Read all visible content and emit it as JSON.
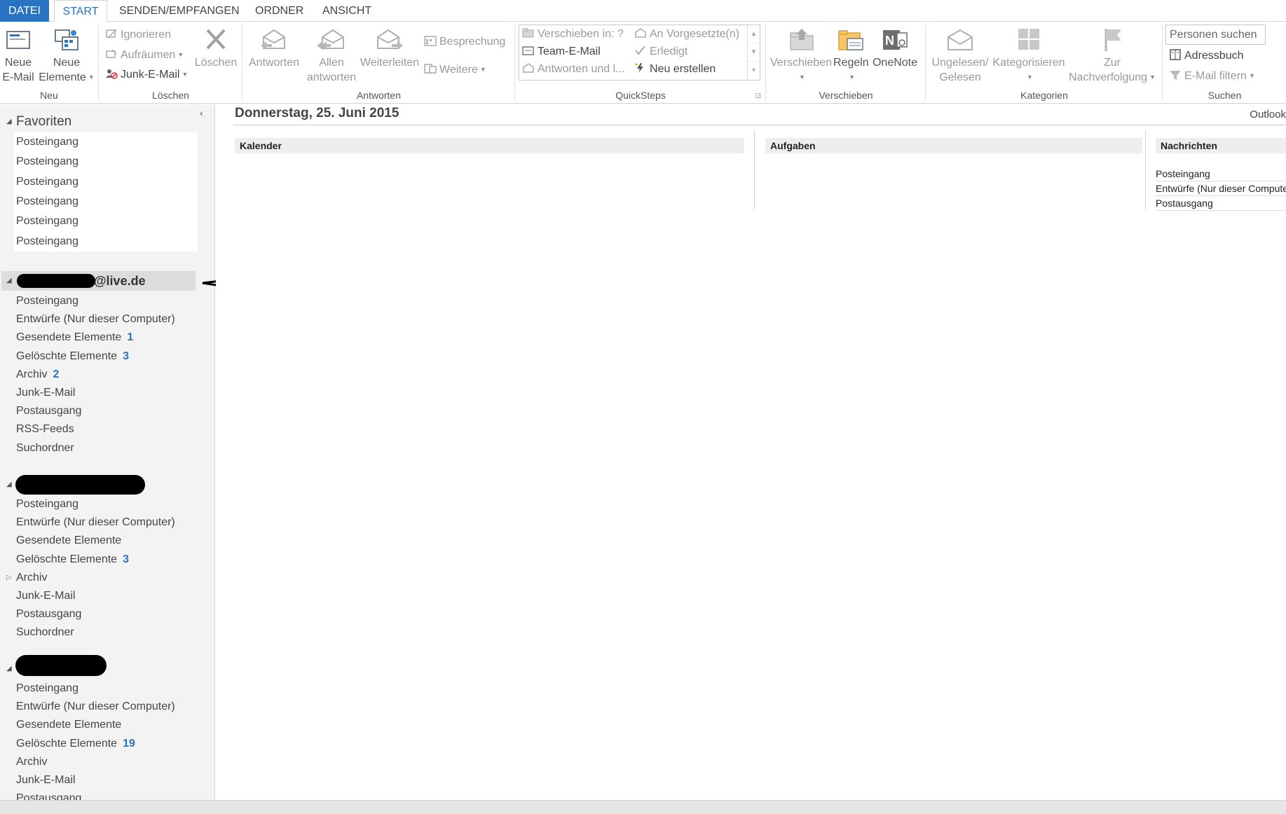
{
  "tabs": {
    "file": "DATEI",
    "start": "START",
    "send_receive": "SENDEN/EMPFANGEN",
    "folder": "ORDNER",
    "view": "ANSICHT"
  },
  "ribbon": {
    "new_group": {
      "label": "Neu",
      "new_email_line1": "Neue",
      "new_email_line2": "E-Mail",
      "new_items_line1": "Neue",
      "new_items_line2": "Elemente"
    },
    "delete_group": {
      "label": "Löschen",
      "ignore": "Ignorieren",
      "cleanup": "Aufräumen",
      "junk": "Junk-E-Mail",
      "delete": "Löschen"
    },
    "respond_group": {
      "label": "Antworten",
      "reply": "Antworten",
      "reply_all_line1": "Allen",
      "reply_all_line2": "antworten",
      "forward": "Weiterleiten",
      "meeting": "Besprechung",
      "more": "Weitere"
    },
    "quicksteps_group": {
      "label": "QuickSteps",
      "move_to": "Verschieben in: ?",
      "to_manager": "An Vorgesetzte(n)",
      "team_email": "Team-E-Mail",
      "done": "Erledigt",
      "reply_delete": "Antworten und l...",
      "create_new": "Neu erstellen"
    },
    "move_group": {
      "label": "Verschieben",
      "move": "Verschieben",
      "rules": "Regeln",
      "onenote": "OneNote"
    },
    "tags_group": {
      "label": "Kategorien",
      "unread_line1": "Ungelesen/",
      "unread_line2": "Gelesen",
      "categorize": "Kategorisieren",
      "followup_line1": "Zur",
      "followup_line2": "Nachverfolgung"
    },
    "find_group": {
      "label": "Suchen",
      "search_people_placeholder": "Personen suchen",
      "address_book": "Adressbuch",
      "filter_email": "E-Mail filtern"
    }
  },
  "navpane": {
    "favorites_title": "Favoriten",
    "favorites": [
      "Posteingang",
      "Posteingang",
      "Posteingang",
      "Posteingang",
      "Posteingang",
      "Posteingang"
    ],
    "account1": {
      "name": "@live.de",
      "folders": [
        {
          "name": "Posteingang",
          "count": ""
        },
        {
          "name": "Entwürfe (Nur dieser Computer)",
          "count": ""
        },
        {
          "name": "Gesendete Elemente",
          "count": "1"
        },
        {
          "name": "Gelöschte Elemente",
          "count": "3"
        },
        {
          "name": "Archiv",
          "count": "2"
        },
        {
          "name": "Junk-E-Mail",
          "count": ""
        },
        {
          "name": "Postausgang",
          "count": ""
        },
        {
          "name": "RSS-Feeds",
          "count": ""
        },
        {
          "name": "Suchordner",
          "count": ""
        }
      ]
    },
    "account2": {
      "folders": [
        {
          "name": "Posteingang",
          "count": ""
        },
        {
          "name": "Entwürfe (Nur dieser Computer)",
          "count": ""
        },
        {
          "name": "Gesendete Elemente",
          "count": ""
        },
        {
          "name": "Gelöschte Elemente",
          "count": "3"
        },
        {
          "name": "Archiv",
          "count": ""
        },
        {
          "name": "Junk-E-Mail",
          "count": ""
        },
        {
          "name": "Postausgang",
          "count": ""
        },
        {
          "name": "Suchordner",
          "count": ""
        }
      ]
    },
    "account3": {
      "folders": [
        {
          "name": "Posteingang",
          "count": ""
        },
        {
          "name": "Entwürfe (Nur dieser Computer)",
          "count": ""
        },
        {
          "name": "Gesendete Elemente",
          "count": ""
        },
        {
          "name": "Gelöschte Elemente",
          "count": "19"
        },
        {
          "name": "Archiv",
          "count": ""
        },
        {
          "name": "Junk-E-Mail",
          "count": ""
        },
        {
          "name": "Postausgang",
          "count": ""
        }
      ]
    }
  },
  "main": {
    "date": "Donnerstag, 25. Juni 2015",
    "outlook_label": "Outlook",
    "calendar_header": "Kalender",
    "tasks_header": "Aufgaben",
    "messages_header": "Nachrichten",
    "messages": [
      "Posteingang",
      "Entwürfe (Nur dieser Computer)",
      "Postausgang"
    ]
  },
  "colors": {
    "accent": "#2a72c2",
    "pane_bg": "#f3f3f3",
    "selected_bg": "#dcdcdc"
  }
}
